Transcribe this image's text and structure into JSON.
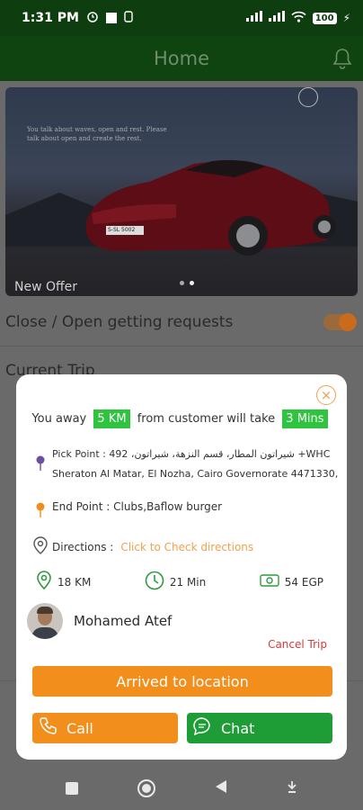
{
  "status": {
    "time": "1:31 PM",
    "battery": "100"
  },
  "app_bar": {
    "title": "Home"
  },
  "banner": {
    "tagline": "You talk about waves, open and rest. Please talk about open and create the rest.",
    "plate": "S-SL 5002",
    "offer_label": "New Offer"
  },
  "requests_toggle": {
    "label": "Close / Open getting requests",
    "on": true
  },
  "current_trip_label": "Current Trip",
  "trip_modal": {
    "summary_prefix": "You away",
    "distance_highlight": "5 KM",
    "summary_mid": "from customer will take",
    "time_highlight": "3 Mins",
    "pick_label": "Pick Point :",
    "pick_line1": "492 ،شيراتون المطار، قسم النزهة، شيراتون +WHC",
    "pick_line2": "Sheraton Al Matar, El Nozha, Cairo Governorate 4471330,",
    "end_label": "End Point :",
    "end_value": "Clubs,Baflow burger",
    "directions_label": "Directions :",
    "directions_link": "Click to Check directions",
    "distance": "18 KM",
    "duration": "21 Min",
    "fare": "54 EGP",
    "driver_name": "Mohamed Atef",
    "cancel_label": "Cancel Trip",
    "arrived_label": "Arrived to location",
    "call_label": "Call",
    "chat_label": "Chat"
  },
  "colors": {
    "primary_green": "#0f4310",
    "accent_orange": "#f28e1c",
    "chat_green": "#1e9c35",
    "highlight_green": "#2ec43f",
    "cancel_red": "#d63a3a"
  },
  "icons": [
    "alarm-icon",
    "signal-icon",
    "wifi-icon",
    "bell-icon",
    "close-icon",
    "pin-icon",
    "directions-icon",
    "location-icon",
    "clock-icon",
    "cash-icon",
    "phone-icon",
    "chat-icon"
  ]
}
